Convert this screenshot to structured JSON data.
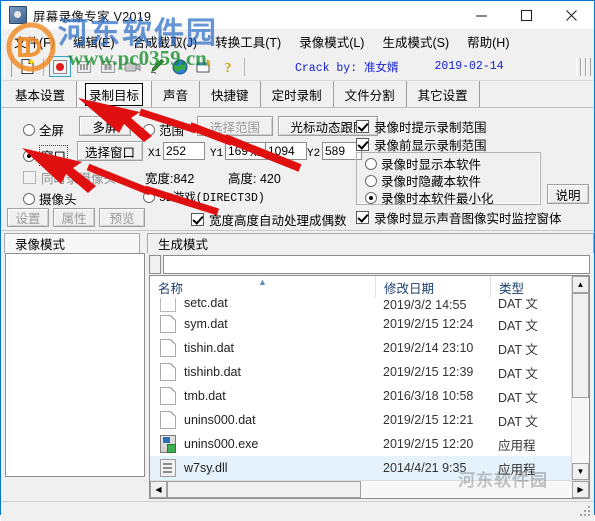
{
  "window": {
    "title": "屏幕录像专家 V2019",
    "icon": "app-icon",
    "controls": {
      "minimize": "—",
      "maximize": "□",
      "close": "✕"
    }
  },
  "menubar": {
    "items": [
      {
        "label": "文件(F)"
      },
      {
        "label": "编辑(E)"
      },
      {
        "label": "合成截取(J)"
      },
      {
        "label": "转换工具(T)"
      },
      {
        "label": "录像模式(L)"
      },
      {
        "label": "生成模式(S)"
      },
      {
        "label": "帮助(H)"
      }
    ]
  },
  "toolbar": {
    "icons": [
      {
        "name": "new-file-icon"
      },
      {
        "name": "record-icon"
      },
      {
        "name": "stop-icon"
      },
      {
        "name": "pause-icon"
      },
      {
        "name": "camera-icon"
      },
      {
        "name": "pen-icon"
      },
      {
        "name": "globe-icon"
      },
      {
        "name": "export-icon"
      },
      {
        "name": "help-icon"
      }
    ],
    "crack_label": "Crack by: ",
    "crack_author": "准女婿",
    "date": "2019-02-14"
  },
  "tabs": {
    "items": [
      {
        "label": "基本设置",
        "selected": false
      },
      {
        "label": "录制目标",
        "selected": true
      },
      {
        "label": "声音",
        "selected": false
      },
      {
        "label": "快捷键",
        "selected": false
      },
      {
        "label": "定时录制",
        "selected": false
      },
      {
        "label": "文件分割",
        "selected": false
      },
      {
        "label": "其它设置",
        "selected": false
      }
    ]
  },
  "settings": {
    "target_mode": {
      "fullscreen": {
        "label": "全屏",
        "checked": false,
        "disabled": false
      },
      "window": {
        "label": "窗口",
        "checked": true,
        "disabled": false
      },
      "range": {
        "label": "范围",
        "checked": false,
        "disabled": false
      },
      "camera": {
        "label": "摄像头",
        "checked": false,
        "disabled": false
      },
      "d3d": {
        "label": "3D游戏(DIRECT3D)",
        "checked": false,
        "disabled": false
      }
    },
    "buttons": {
      "multiscreen": "多屏",
      "select_window": "选择窗口",
      "select_range": "选择范围",
      "cursor_follow": "光标动态跟随",
      "settings": "设置",
      "properties": "属性",
      "preview": "预览",
      "help": "说明"
    },
    "coords": {
      "x1_label": "X1:",
      "x1_value": "252",
      "y1_label": "Y1:",
      "y1_value": "169",
      "x2_label": "X2:",
      "x2_value": "1094",
      "y2_label": "Y2:",
      "y2_value": "589"
    },
    "dimensions": {
      "width_label": "宽度:842",
      "height_label": "高度: 420"
    },
    "record_camera": {
      "label": "同时录摄像头",
      "checked": false,
      "disabled": true
    },
    "even_size": {
      "label": "宽度高度自动处理成偶数",
      "checked": true
    },
    "right_options": {
      "prompt_range": {
        "label": "录像时提示录制范围",
        "checked": true
      },
      "show_range_before": {
        "label": "录像前显示录制范围",
        "checked": true
      },
      "show_app": {
        "label": "录像时显示本软件",
        "checked": false
      },
      "hide_app": {
        "label": "录像时隐藏本软件",
        "checked": false
      },
      "minimize_app": {
        "label": "录像时本软件最小化",
        "checked": true
      },
      "monitor_window": {
        "label": "录像时显示声音图像实时监控窗体",
        "checked": true
      }
    }
  },
  "bottom": {
    "tabs": [
      {
        "label": "录像模式",
        "selected": true
      },
      {
        "label": "生成模式",
        "selected": false
      }
    ],
    "path_value": ""
  },
  "explorer": {
    "columns": [
      {
        "label": "名称",
        "key": "name"
      },
      {
        "label": "修改日期",
        "key": "date"
      },
      {
        "label": "类型",
        "key": "type"
      }
    ],
    "rows": [
      {
        "name": "setc.dat",
        "date": "2019/3/2 14:55",
        "type": "DAT 文",
        "icon": "file-dat-icon",
        "selected": false
      },
      {
        "name": "sym.dat",
        "date": "2019/2/15 12:24",
        "type": "DAT 文",
        "icon": "file-dat-icon",
        "selected": false
      },
      {
        "name": "tishin.dat",
        "date": "2019/2/14 23:10",
        "type": "DAT 文",
        "icon": "file-dat-icon",
        "selected": false
      },
      {
        "name": "tishinb.dat",
        "date": "2019/2/15 12:39",
        "type": "DAT 文",
        "icon": "file-dat-icon",
        "selected": false
      },
      {
        "name": "tmb.dat",
        "date": "2016/3/18 10:58",
        "type": "DAT 文",
        "icon": "file-dat-icon",
        "selected": false
      },
      {
        "name": "unins000.dat",
        "date": "2019/2/15 12:21",
        "type": "DAT 文",
        "icon": "file-dat-icon",
        "selected": false
      },
      {
        "name": "unins000.exe",
        "date": "2019/2/15 12:20",
        "type": "应用程",
        "icon": "file-exe-icon",
        "selected": false
      },
      {
        "name": "w7sy.dll",
        "date": "2014/4/21 9:35",
        "type": "应用程",
        "icon": "file-dll-icon",
        "selected": true
      }
    ]
  },
  "watermark": {
    "site_cn": "河东软件园",
    "site_url": "www.pc0359.cn",
    "bottom": "河东软件园"
  }
}
